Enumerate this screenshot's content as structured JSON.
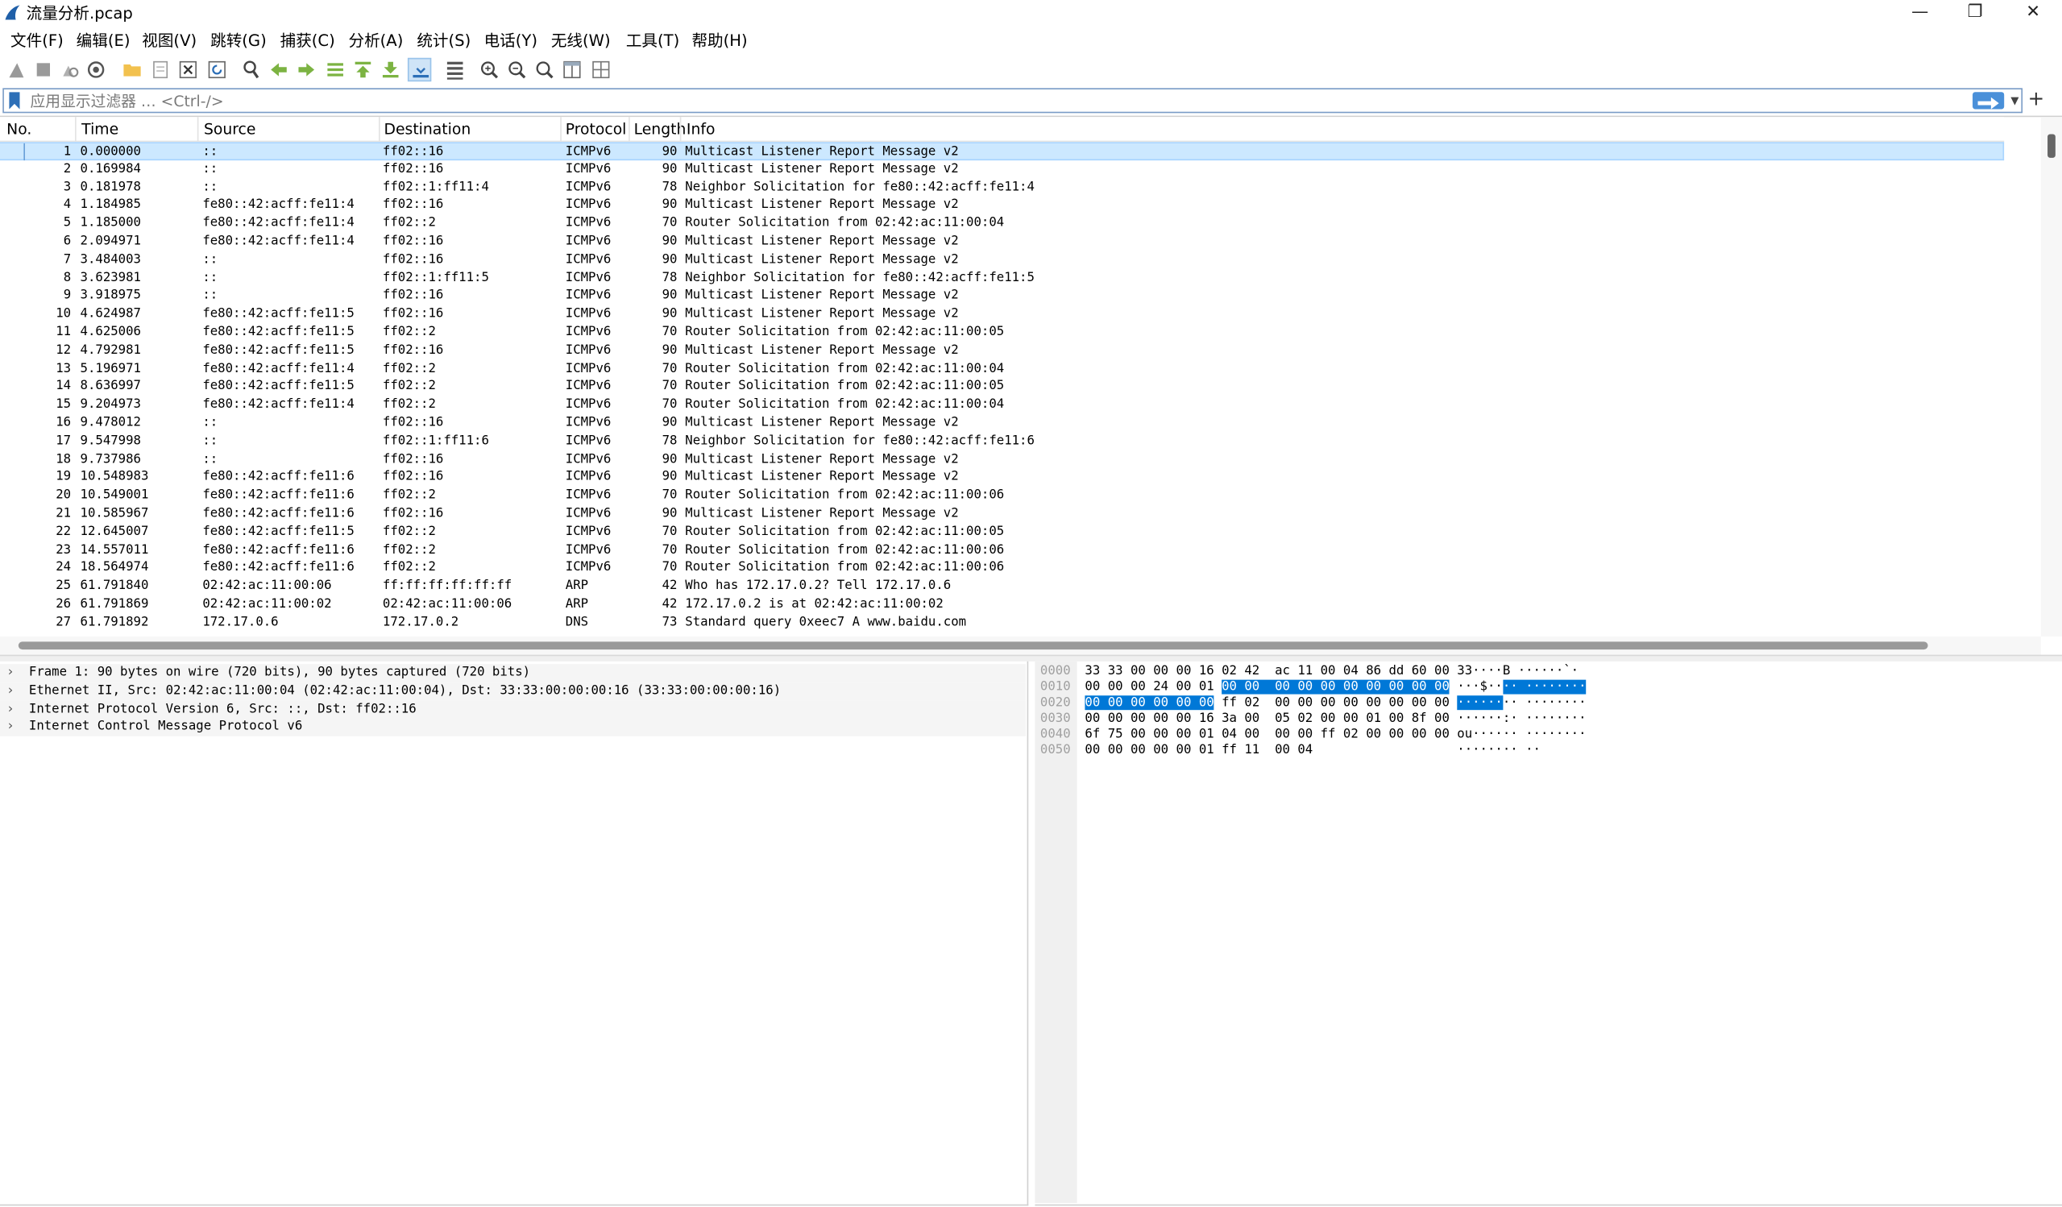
{
  "window": {
    "title": "流量分析.pcap"
  },
  "menu": [
    "文件(F)",
    "编辑(E)",
    "视图(V)",
    "跳转(G)",
    "捕获(C)",
    "分析(A)",
    "统计(S)",
    "电话(Y)",
    "无线(W)",
    "工具(T)",
    "帮助(H)"
  ],
  "toolbar_icons": [
    "start-capture-icon",
    "stop-capture-icon",
    "restart-capture-icon",
    "capture-options-icon",
    "open-file-icon",
    "save-file-icon",
    "close-file-icon",
    "reload-file-icon",
    "find-packet-icon",
    "go-back-icon",
    "go-forward-icon",
    "go-to-packet-icon",
    "first-packet-icon",
    "last-packet-icon",
    "auto-scroll-icon",
    "colorize-icon",
    "zoom-in-icon",
    "zoom-out-icon",
    "normal-size-icon",
    "resize-columns-icon",
    "layout-icon"
  ],
  "filter": {
    "placeholder": "应用显示过滤器 … <Ctrl-/>"
  },
  "packet_list": {
    "columns": {
      "no": "No.",
      "time": "Time",
      "source": "Source",
      "destination": "Destination",
      "protocol": "Protocol",
      "length": "Length",
      "info": "Info"
    },
    "selected_row": 1,
    "rows": [
      {
        "no": "1",
        "time": "0.000000",
        "src": "::",
        "dst": "ff02::16",
        "proto": "ICMPv6",
        "len": "90",
        "info": "Multicast Listener Report Message v2"
      },
      {
        "no": "2",
        "time": "0.169984",
        "src": "::",
        "dst": "ff02::16",
        "proto": "ICMPv6",
        "len": "90",
        "info": "Multicast Listener Report Message v2"
      },
      {
        "no": "3",
        "time": "0.181978",
        "src": "::",
        "dst": "ff02::1:ff11:4",
        "proto": "ICMPv6",
        "len": "78",
        "info": "Neighbor Solicitation for fe80::42:acff:fe11:4"
      },
      {
        "no": "4",
        "time": "1.184985",
        "src": "fe80::42:acff:fe11:4",
        "dst": "ff02::16",
        "proto": "ICMPv6",
        "len": "90",
        "info": "Multicast Listener Report Message v2"
      },
      {
        "no": "5",
        "time": "1.185000",
        "src": "fe80::42:acff:fe11:4",
        "dst": "ff02::2",
        "proto": "ICMPv6",
        "len": "70",
        "info": "Router Solicitation from 02:42:ac:11:00:04"
      },
      {
        "no": "6",
        "time": "2.094971",
        "src": "fe80::42:acff:fe11:4",
        "dst": "ff02::16",
        "proto": "ICMPv6",
        "len": "90",
        "info": "Multicast Listener Report Message v2"
      },
      {
        "no": "7",
        "time": "3.484003",
        "src": "::",
        "dst": "ff02::16",
        "proto": "ICMPv6",
        "len": "90",
        "info": "Multicast Listener Report Message v2"
      },
      {
        "no": "8",
        "time": "3.623981",
        "src": "::",
        "dst": "ff02::1:ff11:5",
        "proto": "ICMPv6",
        "len": "78",
        "info": "Neighbor Solicitation for fe80::42:acff:fe11:5"
      },
      {
        "no": "9",
        "time": "3.918975",
        "src": "::",
        "dst": "ff02::16",
        "proto": "ICMPv6",
        "len": "90",
        "info": "Multicast Listener Report Message v2"
      },
      {
        "no": "10",
        "time": "4.624987",
        "src": "fe80::42:acff:fe11:5",
        "dst": "ff02::16",
        "proto": "ICMPv6",
        "len": "90",
        "info": "Multicast Listener Report Message v2"
      },
      {
        "no": "11",
        "time": "4.625006",
        "src": "fe80::42:acff:fe11:5",
        "dst": "ff02::2",
        "proto": "ICMPv6",
        "len": "70",
        "info": "Router Solicitation from 02:42:ac:11:00:05"
      },
      {
        "no": "12",
        "time": "4.792981",
        "src": "fe80::42:acff:fe11:5",
        "dst": "ff02::16",
        "proto": "ICMPv6",
        "len": "90",
        "info": "Multicast Listener Report Message v2"
      },
      {
        "no": "13",
        "time": "5.196971",
        "src": "fe80::42:acff:fe11:4",
        "dst": "ff02::2",
        "proto": "ICMPv6",
        "len": "70",
        "info": "Router Solicitation from 02:42:ac:11:00:04"
      },
      {
        "no": "14",
        "time": "8.636997",
        "src": "fe80::42:acff:fe11:5",
        "dst": "ff02::2",
        "proto": "ICMPv6",
        "len": "70",
        "info": "Router Solicitation from 02:42:ac:11:00:05"
      },
      {
        "no": "15",
        "time": "9.204973",
        "src": "fe80::42:acff:fe11:4",
        "dst": "ff02::2",
        "proto": "ICMPv6",
        "len": "70",
        "info": "Router Solicitation from 02:42:ac:11:00:04"
      },
      {
        "no": "16",
        "time": "9.478012",
        "src": "::",
        "dst": "ff02::16",
        "proto": "ICMPv6",
        "len": "90",
        "info": "Multicast Listener Report Message v2"
      },
      {
        "no": "17",
        "time": "9.547998",
        "src": "::",
        "dst": "ff02::1:ff11:6",
        "proto": "ICMPv6",
        "len": "78",
        "info": "Neighbor Solicitation for fe80::42:acff:fe11:6"
      },
      {
        "no": "18",
        "time": "9.737986",
        "src": "::",
        "dst": "ff02::16",
        "proto": "ICMPv6",
        "len": "90",
        "info": "Multicast Listener Report Message v2"
      },
      {
        "no": "19",
        "time": "10.548983",
        "src": "fe80::42:acff:fe11:6",
        "dst": "ff02::16",
        "proto": "ICMPv6",
        "len": "90",
        "info": "Multicast Listener Report Message v2"
      },
      {
        "no": "20",
        "time": "10.549001",
        "src": "fe80::42:acff:fe11:6",
        "dst": "ff02::2",
        "proto": "ICMPv6",
        "len": "70",
        "info": "Router Solicitation from 02:42:ac:11:00:06"
      },
      {
        "no": "21",
        "time": "10.585967",
        "src": "fe80::42:acff:fe11:6",
        "dst": "ff02::16",
        "proto": "ICMPv6",
        "len": "90",
        "info": "Multicast Listener Report Message v2"
      },
      {
        "no": "22",
        "time": "12.645007",
        "src": "fe80::42:acff:fe11:5",
        "dst": "ff02::2",
        "proto": "ICMPv6",
        "len": "70",
        "info": "Router Solicitation from 02:42:ac:11:00:05"
      },
      {
        "no": "23",
        "time": "14.557011",
        "src": "fe80::42:acff:fe11:6",
        "dst": "ff02::2",
        "proto": "ICMPv6",
        "len": "70",
        "info": "Router Solicitation from 02:42:ac:11:00:06"
      },
      {
        "no": "24",
        "time": "18.564974",
        "src": "fe80::42:acff:fe11:6",
        "dst": "ff02::2",
        "proto": "ICMPv6",
        "len": "70",
        "info": "Router Solicitation from 02:42:ac:11:00:06"
      },
      {
        "no": "25",
        "time": "61.791840",
        "src": "02:42:ac:11:00:06",
        "dst": "ff:ff:ff:ff:ff:ff",
        "proto": "ARP",
        "len": "42",
        "info": "Who has 172.17.0.2? Tell 172.17.0.6"
      },
      {
        "no": "26",
        "time": "61.791869",
        "src": "02:42:ac:11:00:02",
        "dst": "02:42:ac:11:00:06",
        "proto": "ARP",
        "len": "42",
        "info": "172.17.0.2 is at 02:42:ac:11:00:02"
      },
      {
        "no": "27",
        "time": "61.791892",
        "src": "172.17.0.6",
        "dst": "172.17.0.2",
        "proto": "DNS",
        "len": "73",
        "info": "Standard query 0xeec7 A www.baidu.com"
      }
    ]
  },
  "details": [
    "Frame 1: 90 bytes on wire (720 bits), 90 bytes captured (720 bits)",
    "Ethernet II, Src: 02:42:ac:11:00:04 (02:42:ac:11:00:04), Dst: 33:33:00:00:00:16 (33:33:00:00:00:16)",
    "Internet Protocol Version 6, Src: ::, Dst: ff02::16",
    "Internet Control Message Protocol v6"
  ],
  "bytes": [
    {
      "offset": "0000",
      "hex": [
        {
          "t": "33 33 00 00 00 16 02 42  ac 11 00 04 86 dd 60 00",
          "hl": false
        }
      ],
      "ascii": [
        {
          "t": "33····B ······`·",
          "hl": false
        }
      ]
    },
    {
      "offset": "0010",
      "hex": [
        {
          "t": "00 00 00 24 00 01 ",
          "hl": false
        },
        {
          "t": "00 00  00 00 00 00 00 00 00 00",
          "hl": true
        }
      ],
      "ascii": [
        {
          "t": "···$··",
          "hl": false
        },
        {
          "t": "·· ········",
          "hl": true
        }
      ]
    },
    {
      "offset": "0020",
      "hex": [
        {
          "t": "00 00 00 00 00 00",
          "hl": true
        },
        {
          "t": " ff 02  00 00 00 00 00 00 00 00",
          "hl": false
        }
      ],
      "ascii": [
        {
          "t": "······",
          "hl": true
        },
        {
          "t": "·· ········",
          "hl": false
        }
      ]
    },
    {
      "offset": "0030",
      "hex": [
        {
          "t": "00 00 00 00 00 16 3a 00  05 02 00 00 01 00 8f 00",
          "hl": false
        }
      ],
      "ascii": [
        {
          "t": "······:· ········",
          "hl": false
        }
      ]
    },
    {
      "offset": "0040",
      "hex": [
        {
          "t": "6f 75 00 00 00 01 04 00  00 00 ff 02 00 00 00 00",
          "hl": false
        }
      ],
      "ascii": [
        {
          "t": "ou······ ········",
          "hl": false
        }
      ]
    },
    {
      "offset": "0050",
      "hex": [
        {
          "t": "00 00 00 00 00 01 ff 11  00 04",
          "hl": false
        }
      ],
      "ascii": [
        {
          "t": "········ ··",
          "hl": false
        }
      ]
    }
  ],
  "colors": {
    "selected_row": "#cce8ff",
    "byte_highlight": "#0078d7",
    "app_icon": "#1f5fa8"
  }
}
